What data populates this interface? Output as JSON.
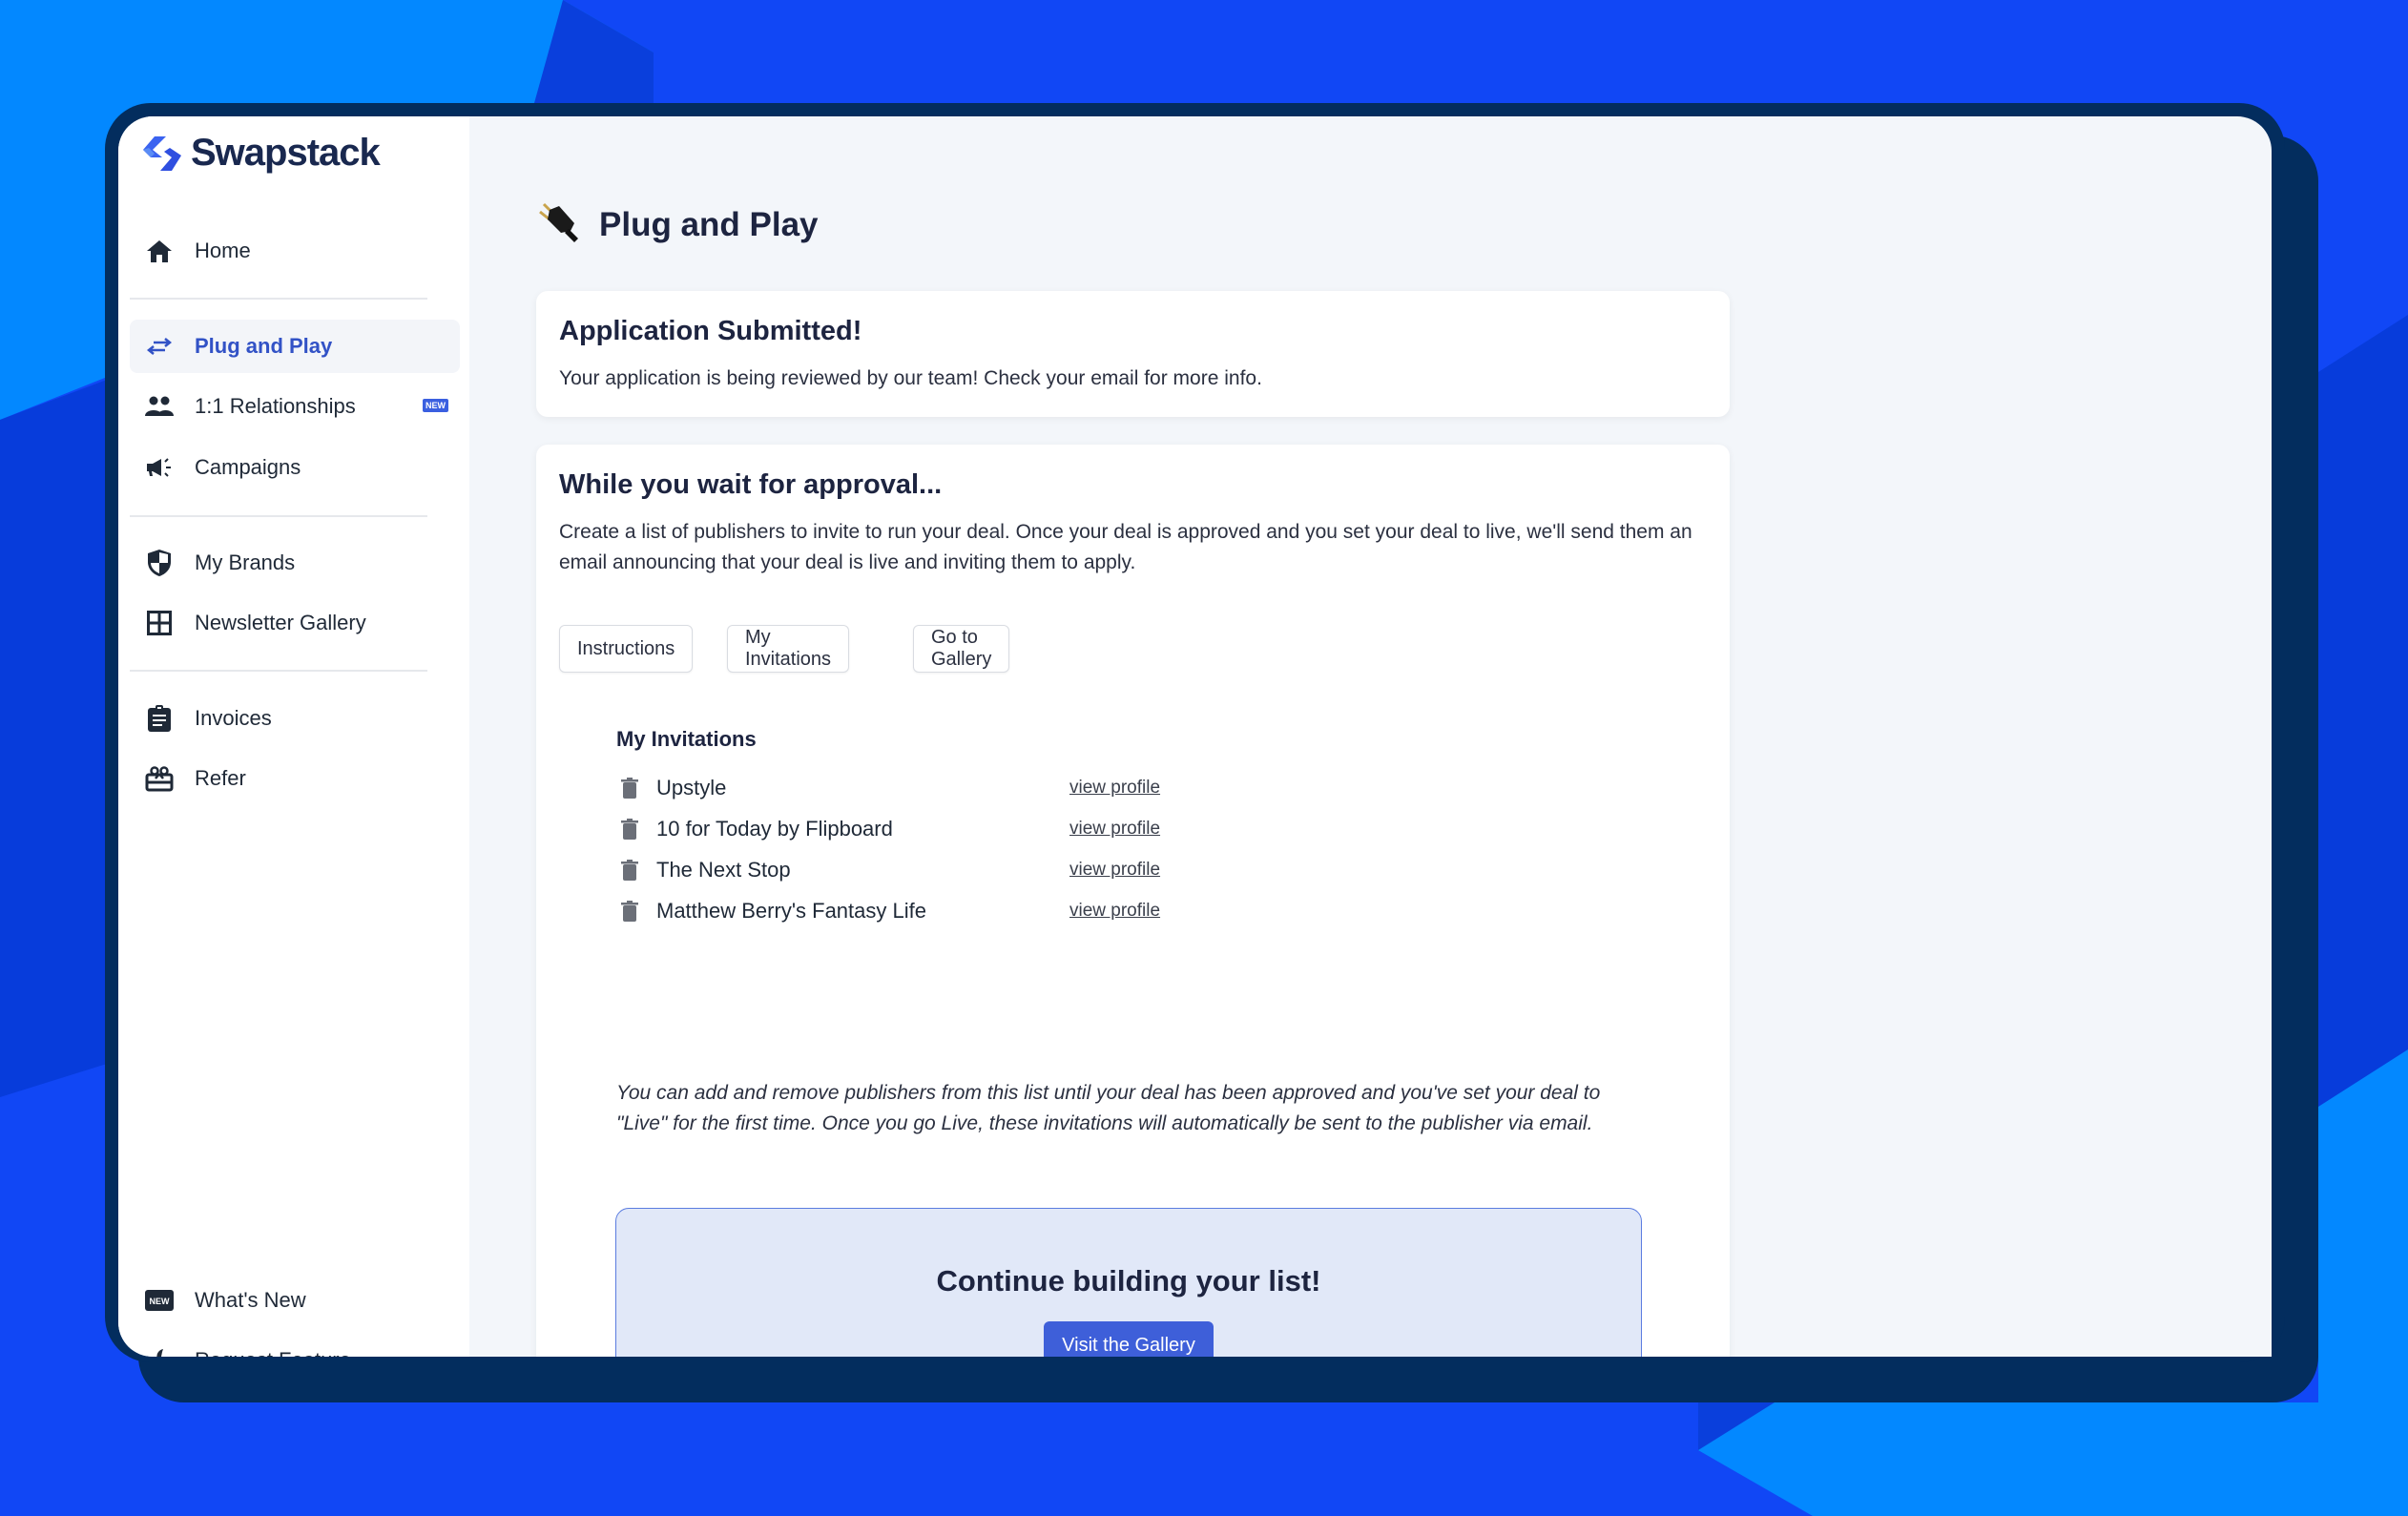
{
  "app": {
    "brand_name": "Swapstack",
    "colors": {
      "background": "#1147f5",
      "frame": "#032d5e",
      "accent": "#3e5fd9",
      "active_nav": "#3252c6",
      "cta_bg": "#e1e8f8"
    }
  },
  "sidebar": {
    "items": [
      {
        "label": "Home",
        "icon": "home-icon"
      },
      {
        "label": "Plug and Play",
        "icon": "swap-arrows-icon",
        "active": true
      },
      {
        "label": "1:1 Relationships",
        "icon": "users-icon",
        "badge": "NEW"
      },
      {
        "label": "Campaigns",
        "icon": "megaphone-icon"
      },
      {
        "label": "My Brands",
        "icon": "shield-icon"
      },
      {
        "label": "Newsletter Gallery",
        "icon": "grid-icon"
      },
      {
        "label": "Invoices",
        "icon": "clipboard-icon"
      },
      {
        "label": "Refer",
        "icon": "gift-icon"
      },
      {
        "label": "What's New",
        "icon": "new-badge-icon"
      },
      {
        "label": "Request Feature",
        "icon": "wrench-icon"
      }
    ]
  },
  "page": {
    "title": "Plug and Play",
    "title_icon": "plug-icon"
  },
  "submitted_card": {
    "heading": "Application Submitted!",
    "body": "Your application is being reviewed by our team! Check your email for more info."
  },
  "approval_card": {
    "heading": "While you wait for approval...",
    "body": "Create a list of publishers to invite to run your deal. Once your deal is approved and you set your deal to live, we'll send them an email announcing that your deal is live and inviting them to apply.",
    "buttons": [
      "Instructions",
      "My Invitations",
      "Go to Gallery"
    ],
    "invitations": {
      "title": "My Invitations",
      "link_label": "view profile",
      "items": [
        "Upstyle",
        "10 for Today by Flipboard",
        "The Next Stop",
        "Matthew Berry's Fantasy Life"
      ]
    },
    "note": "You can add and remove publishers from this list until your deal has been approved and you've set your deal to \"Live\" for the first time. Once you go Live, these invitations will automatically be sent to the publisher via email.",
    "cta": {
      "heading": "Continue building your list!",
      "button": "Visit the Gallery"
    }
  }
}
